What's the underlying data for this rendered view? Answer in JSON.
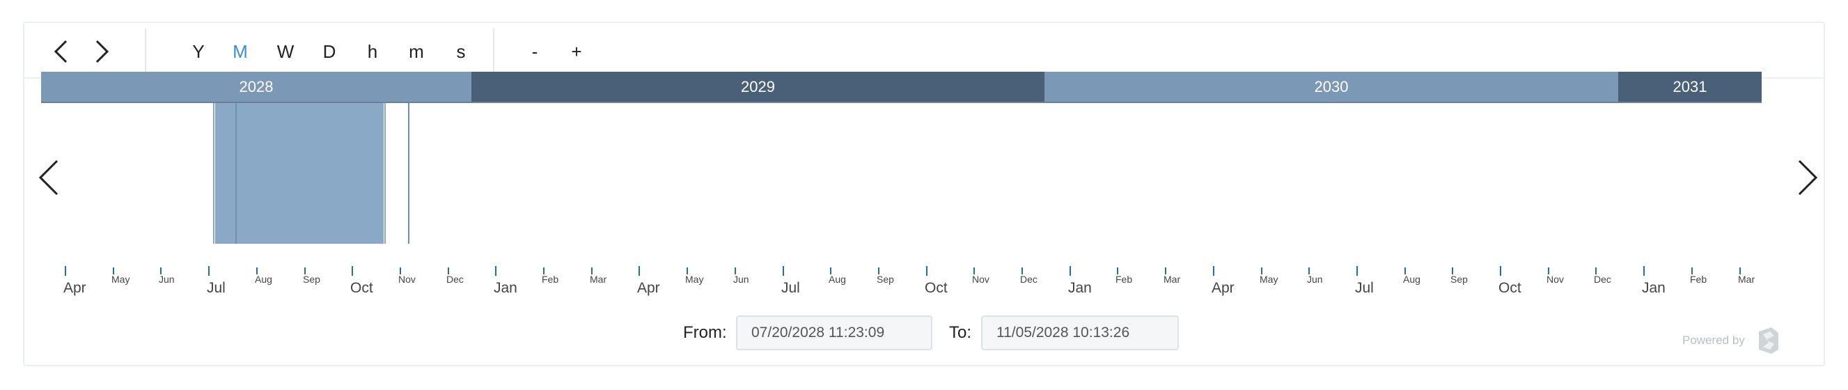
{
  "toolbar": {
    "prev_label": "prev",
    "next_label": "next",
    "units": [
      {
        "label": "Y",
        "active": false
      },
      {
        "label": "M",
        "active": true
      },
      {
        "label": "W",
        "active": false
      },
      {
        "label": "D",
        "active": false
      },
      {
        "label": "h",
        "active": false
      },
      {
        "label": "m",
        "active": false
      },
      {
        "label": "s",
        "active": false
      }
    ],
    "zoom_out": "-",
    "zoom_in": "+"
  },
  "timeline": {
    "years": [
      {
        "label": "2028",
        "color": "#7b99b7"
      },
      {
        "label": "2029",
        "color": "#4a5f78"
      },
      {
        "label": "2030",
        "color": "#7b99b7"
      },
      {
        "label": "2031",
        "color": "#4a5f78"
      }
    ],
    "months": [
      "Apr",
      "May",
      "Jun",
      "Jul",
      "Aug",
      "Sep",
      "Oct",
      "Nov",
      "Dec",
      "Jan",
      "Feb",
      "Mar",
      "Apr",
      "May",
      "Jun",
      "Jul",
      "Aug",
      "Sep",
      "Oct",
      "Nov",
      "Dec",
      "Jan",
      "Feb",
      "Mar",
      "Apr",
      "May",
      "Jun",
      "Jul",
      "Aug",
      "Sep",
      "Oct",
      "Nov",
      "Dec",
      "Jan",
      "Feb",
      "Mar"
    ],
    "selection_color": "#8aa9c6",
    "tick_color": "#1f6fb5"
  },
  "range": {
    "from_label": "From:",
    "from_value": "07/20/2028 11:23:09",
    "to_label": "To:",
    "to_value": "11/05/2028 10:13:26"
  },
  "footer": {
    "powered_by": "Powered by"
  }
}
